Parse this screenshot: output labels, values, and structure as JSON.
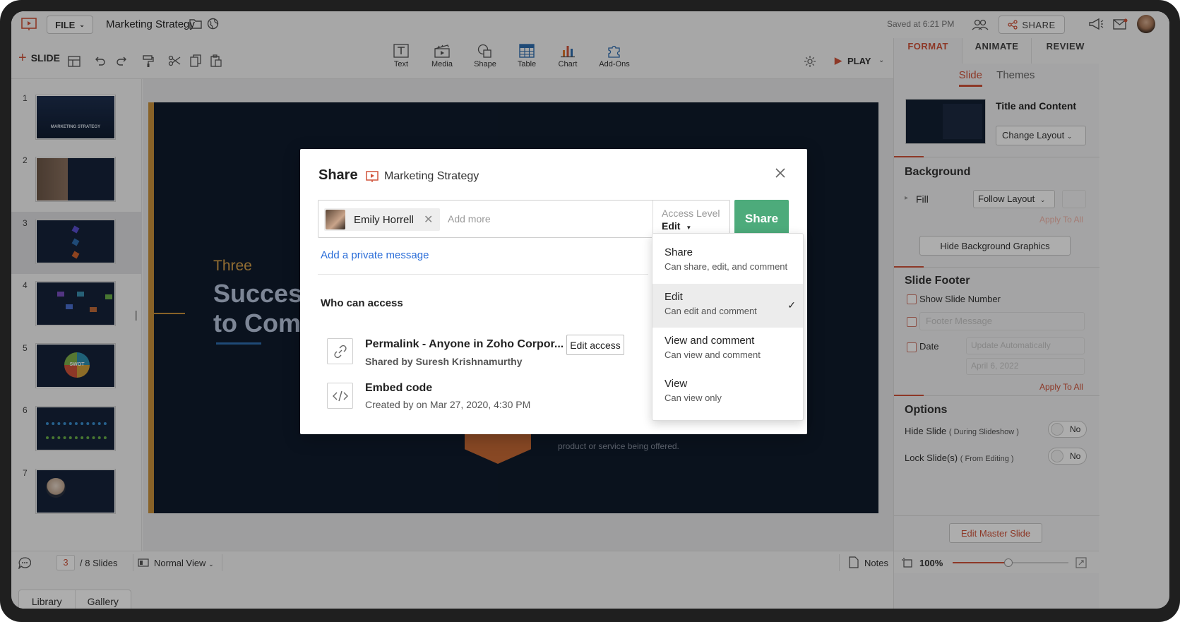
{
  "window": {
    "file_label": "FILE",
    "doc_title": "Marketing Strategy",
    "saved_text": "Saved at 6:21 PM",
    "share_label": "SHARE"
  },
  "toolbar": {
    "slide_label": "SLIDE",
    "insert_tools": [
      "Text",
      "Media",
      "Shape",
      "Table",
      "Chart",
      "Add-Ons"
    ],
    "play_label": "PLAY"
  },
  "right_panel": {
    "tabs": [
      "FORMAT",
      "ANIMATE",
      "REVIEW"
    ],
    "subtabs": [
      "Slide",
      "Themes"
    ],
    "layout_name": "Title and Content",
    "change_layout": "Change Layout",
    "background": {
      "title": "Background",
      "fill_label": "Fill",
      "fill_value": "Follow Layout",
      "apply_all": "Apply To All",
      "hide_graphics": "Hide Background Graphics"
    },
    "footer": {
      "title": "Slide Footer",
      "show_number": "Show Slide Number",
      "footer_placeholder": "Footer Message",
      "date_label": "Date",
      "date_mode": "Update Automatically",
      "date_value": "April 6, 2022",
      "apply_all": "Apply To All"
    },
    "options": {
      "title": "Options",
      "hide_slide": "Hide Slide",
      "hide_slide_note": "( During Slideshow )",
      "hide_slide_value": "No",
      "lock_slide": "Lock Slide(s)",
      "lock_slide_note": "( From Editing )",
      "lock_slide_value": "No"
    },
    "edit_master": "Edit Master Slide"
  },
  "slides_panel": {
    "numbers": [
      "1",
      "2",
      "3",
      "4",
      "5",
      "6",
      "7"
    ],
    "active": 3,
    "thumb1_text": "MARKETING STRATEGY",
    "thumb5_text": "SWOT",
    "library_label": "Library",
    "gallery_label": "Gallery"
  },
  "slide_content": {
    "kicker": "Three",
    "title_line1": "Success",
    "title_line2": "to Comp",
    "body_text": "product or service being offered."
  },
  "status_bar": {
    "current_slide": "3",
    "total_slides": "/ 8 Slides",
    "view_mode": "Normal View",
    "notes_label": "Notes",
    "zoom": "100%",
    "zoom_level": 0.48
  },
  "share_dialog": {
    "title": "Share",
    "doc_name": "Marketing Strategy",
    "recipient_name": "Emily Horrell",
    "add_more_placeholder": "Add more",
    "access_level_label": "Access Level",
    "access_level_value": "Edit",
    "share_button": "Share",
    "private_message": "Add a private message",
    "who_can_access": "Who can access",
    "permalink_title": "Permalink - Anyone in Zoho Corpor...",
    "permalink_sub": "Shared by Suresh Krishnamurthy",
    "edit_access": "Edit access",
    "embed_title": "Embed code",
    "embed_sub": "Created by on Mar 27, 2020, 4:30 PM"
  },
  "access_options": [
    {
      "label": "Share",
      "desc": "Can share, edit, and comment",
      "selected": false
    },
    {
      "label": "Edit",
      "desc": "Can edit and comment",
      "selected": true
    },
    {
      "label": "View and comment",
      "desc": "Can view and comment",
      "selected": false
    },
    {
      "label": "View",
      "desc": "Can view only",
      "selected": false
    }
  ],
  "colors": {
    "accent": "#d0533a",
    "share_green": "#4dab7b",
    "link_blue": "#2a6dd8",
    "slide_bg": "#0f1b2d",
    "slide_gold": "#c9913b"
  }
}
